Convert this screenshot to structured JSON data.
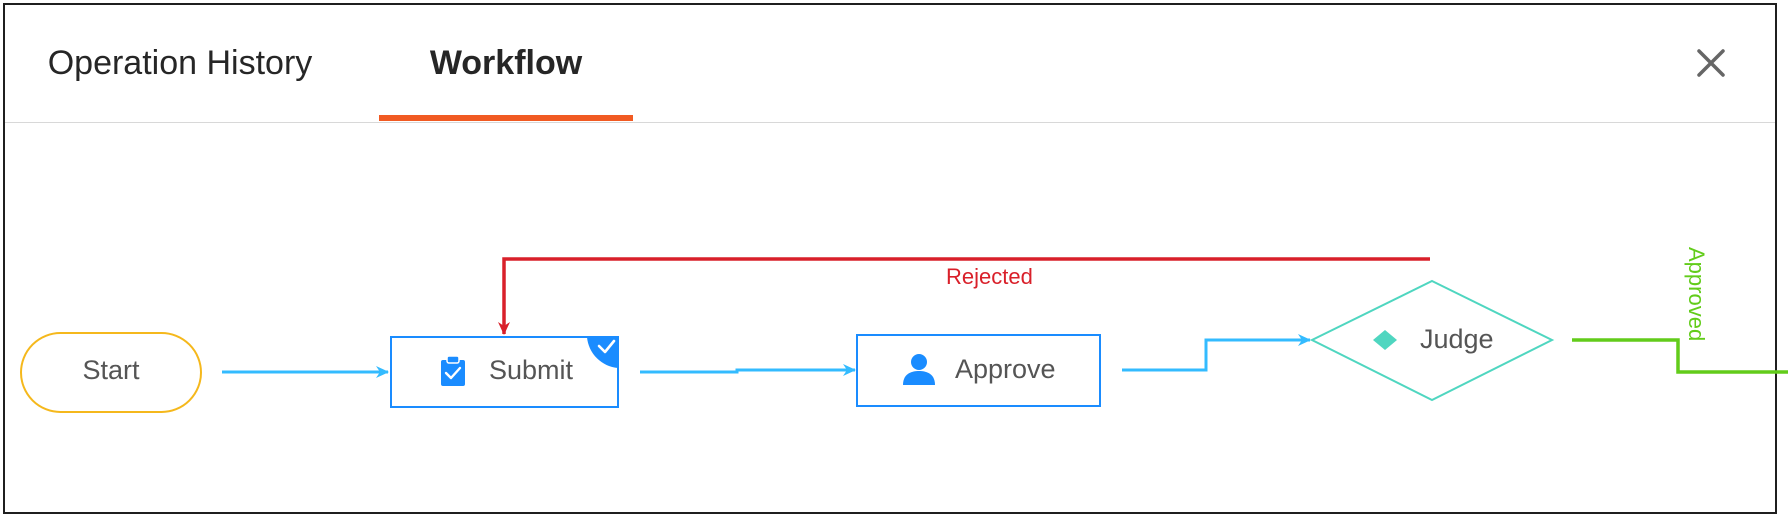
{
  "tabs": [
    {
      "label": "Operation History",
      "active": false
    },
    {
      "label": "Workflow",
      "active": true
    }
  ],
  "workflow": {
    "nodes": {
      "start": {
        "label": "Start",
        "icon": "none"
      },
      "submit": {
        "label": "Submit",
        "icon": "clipboard-check-icon",
        "completed": true
      },
      "approve": {
        "label": "Approve",
        "icon": "user-icon"
      },
      "judge": {
        "label": "Judge",
        "icon": "diamond-icon"
      }
    },
    "edges": {
      "rejected_label": "Rejected",
      "approved_label": "Approved"
    }
  },
  "colors": {
    "active_tab_underline": "#f15a22",
    "node_border": "#1a8cff",
    "flow_line": "#33bbff",
    "start_border": "#f5b81c",
    "judge_border": "#4fd6c0",
    "rejected": "#d9202a",
    "approved": "#62cc1a"
  },
  "icons": {
    "close": "close-icon"
  }
}
